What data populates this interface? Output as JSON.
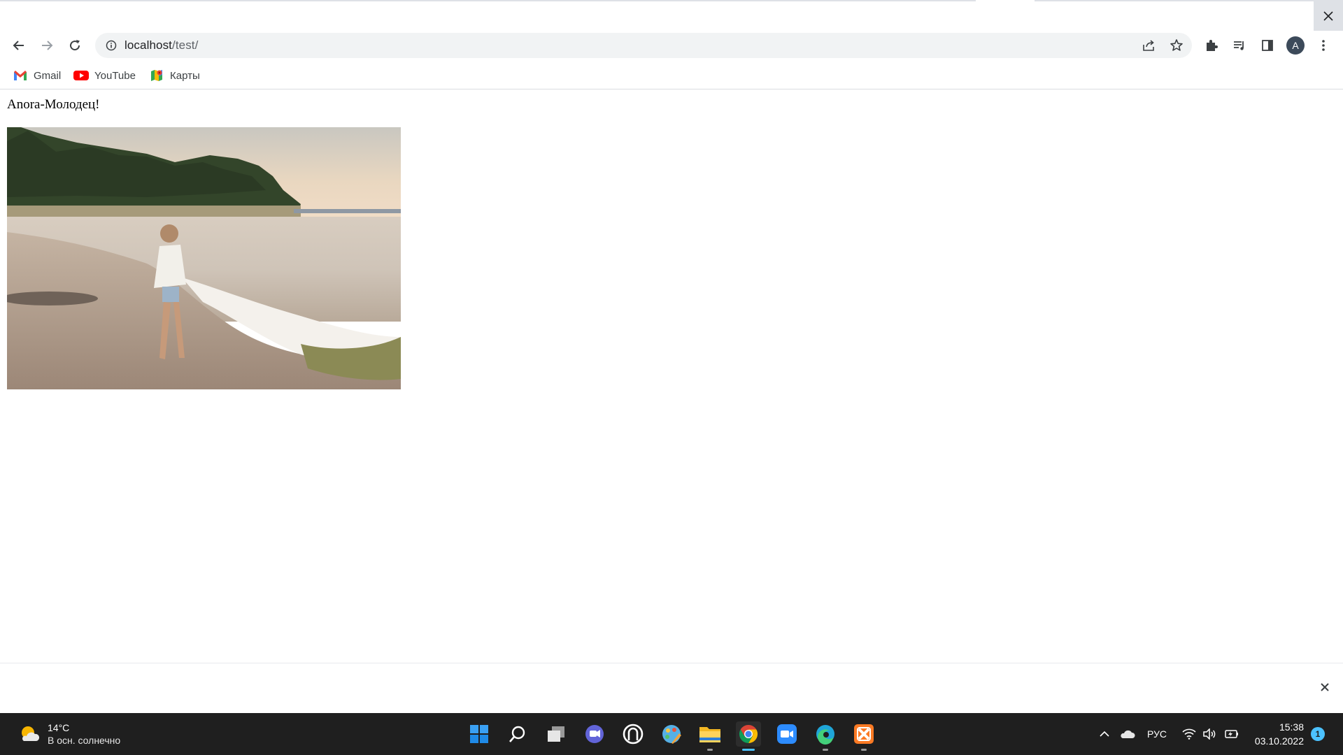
{
  "browser": {
    "url_host": "localhost",
    "url_path": "/test/",
    "avatar_letter": "A"
  },
  "bookmarks": [
    {
      "label": "Gmail",
      "icon": "gmail-icon"
    },
    {
      "label": "YouTube",
      "icon": "youtube-icon"
    },
    {
      "label": "Карты",
      "icon": "maps-icon"
    }
  ],
  "page": {
    "heading": "Anora-Молодец!",
    "image": "beach-photo"
  },
  "taskbar": {
    "weather_temp": "14°C",
    "weather_condition": "В осн. солнечно",
    "language": "РУС",
    "time": "15:38",
    "date": "03.10.2022",
    "notification_count": "1",
    "apps": [
      "start-icon",
      "search-icon",
      "task-view-icon",
      "chat-icon",
      "app-icon",
      "paint-icon",
      "file-explorer-icon",
      "chrome-icon",
      "zoom-icon",
      "edge-icon",
      "xampp-icon"
    ]
  },
  "colors": {
    "accent": "#4cc2ff",
    "taskbar": "#1f1f1f",
    "omnibox": "#f1f3f4"
  }
}
